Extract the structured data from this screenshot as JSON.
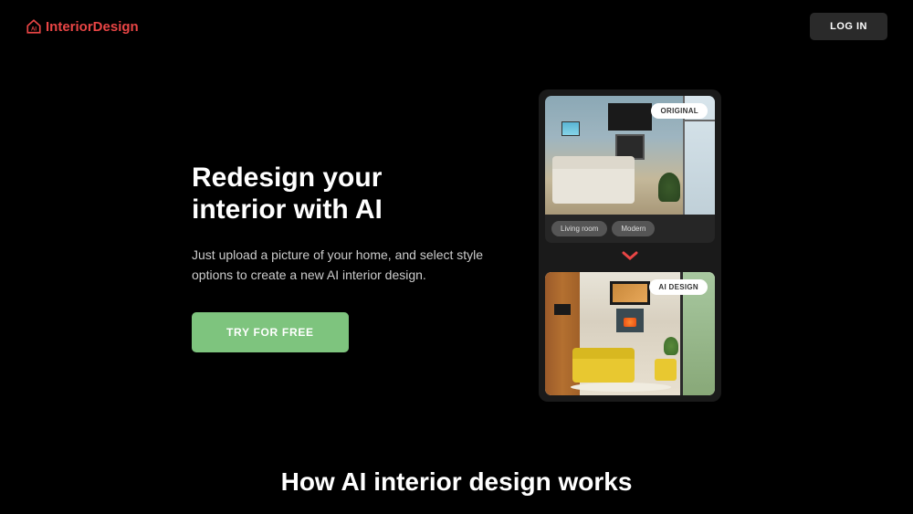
{
  "brand": {
    "name": "InteriorDesign",
    "color": "#e84545"
  },
  "header": {
    "login_label": "LOG IN"
  },
  "hero": {
    "title_line1": "Redesign your",
    "title_line2": "interior with AI",
    "subtitle": "Just upload a picture of your home, and select style options to create a new AI interior design.",
    "cta_label": "TRY FOR FREE"
  },
  "showcase": {
    "original_badge": "ORIGINAL",
    "ai_badge": "AI DESIGN",
    "tags": [
      "Living room",
      "Modern"
    ]
  },
  "section2": {
    "title": "How AI interior design works"
  }
}
